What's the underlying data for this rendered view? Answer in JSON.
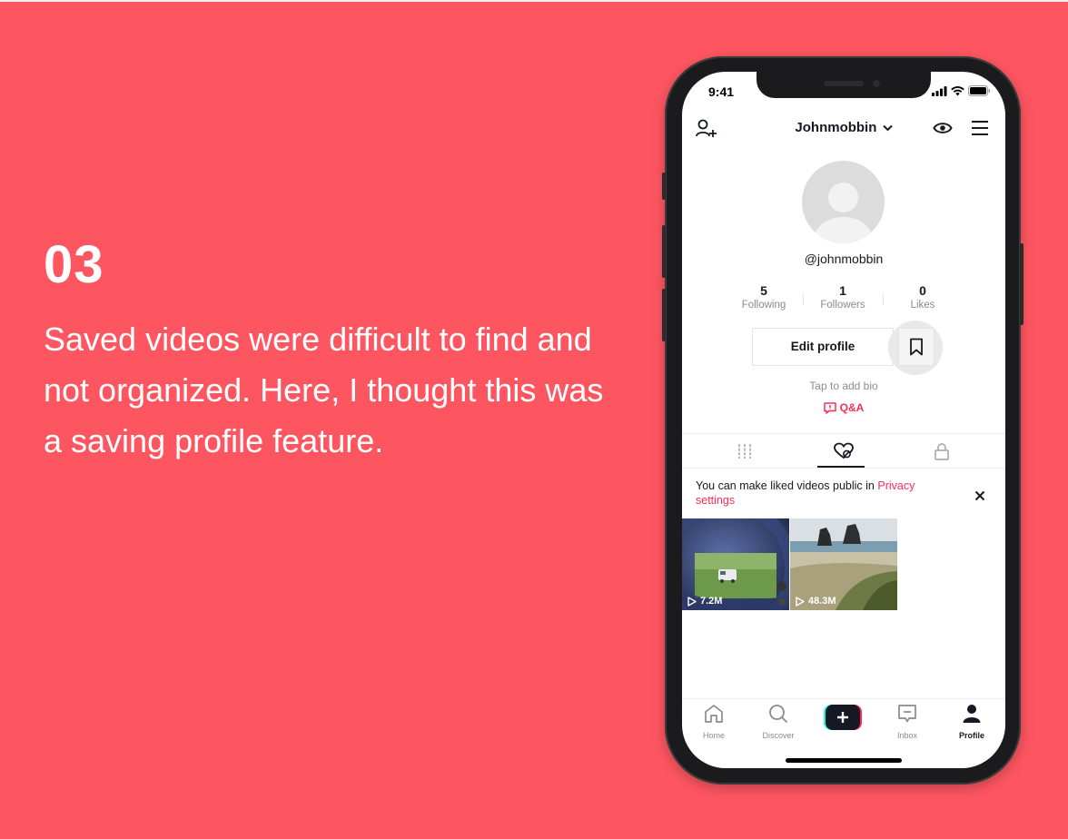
{
  "slide": {
    "number": "03",
    "caption": "Saved videos were difficult to find and not organized. Here, I thought this was a saving profile feature."
  },
  "status_bar": {
    "time": "9:41"
  },
  "profile": {
    "username": "Johnmobbin",
    "handle": "@johnmobbin",
    "stats": [
      {
        "value": "5",
        "label": "Following"
      },
      {
        "value": "1",
        "label": "Followers"
      },
      {
        "value": "0",
        "label": "Likes"
      }
    ],
    "edit_button": "Edit profile",
    "bio_placeholder": "Tap to add bio",
    "qa_label": "Q&A"
  },
  "notice": {
    "text": "You can make liked videos public in ",
    "link": "Privacy settings"
  },
  "videos": [
    {
      "views": "7.2M"
    },
    {
      "views": "48.3M"
    }
  ],
  "bottom_nav": [
    {
      "label": "Home",
      "icon": "home-icon"
    },
    {
      "label": "Discover",
      "icon": "search-icon"
    },
    {
      "label": "",
      "icon": "create-icon"
    },
    {
      "label": "Inbox",
      "icon": "inbox-icon"
    },
    {
      "label": "Profile",
      "icon": "profile-icon"
    }
  ],
  "colors": {
    "background": "#fe5661",
    "accent": "#fe2c55",
    "text": "#161823",
    "muted": "#8a8b91"
  }
}
